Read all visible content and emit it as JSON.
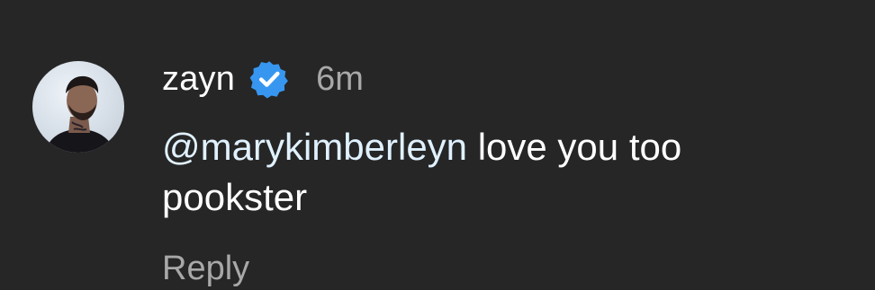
{
  "comment": {
    "username": "zayn",
    "verified_icon": "verified-badge-icon",
    "verified_color": "#3797f0",
    "timestamp": "6m",
    "mention": "@marykimberleyn",
    "text": " love you too pookster",
    "reply_label": "Reply"
  },
  "colors": {
    "background": "#262626",
    "primary_text": "#ffffff",
    "secondary_text": "#a8a8a8",
    "mention_text": "#e0f1ff"
  }
}
